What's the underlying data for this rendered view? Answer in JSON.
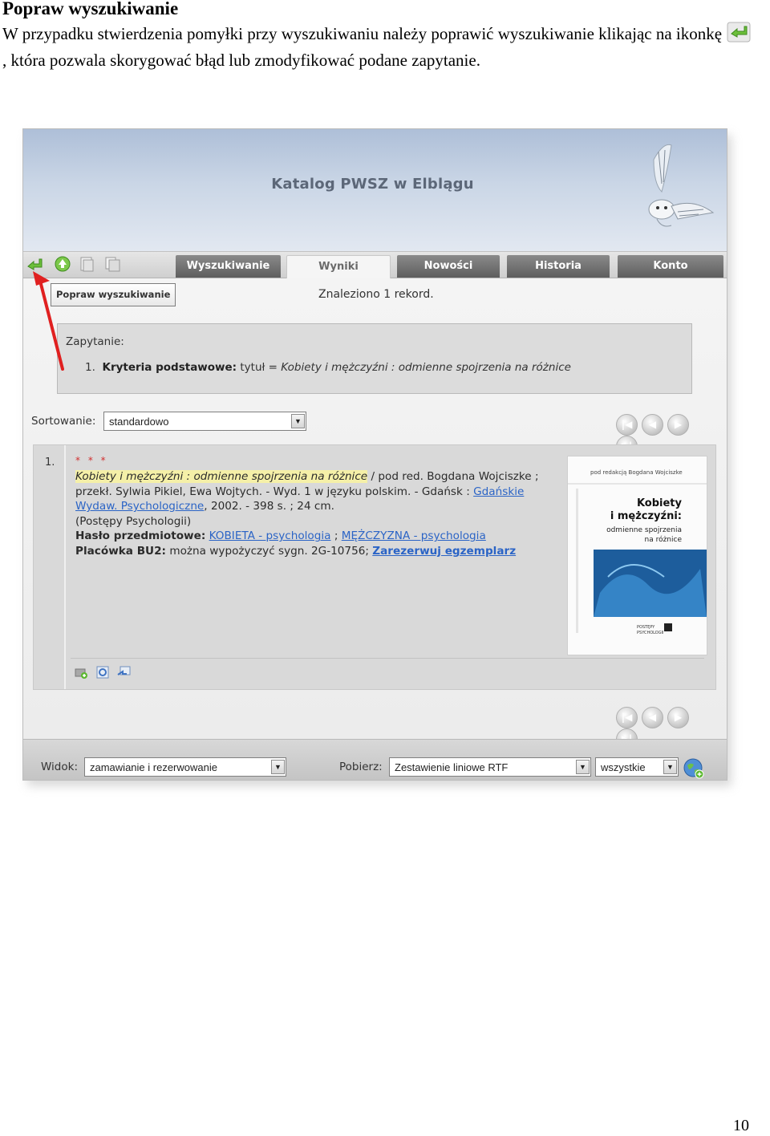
{
  "doc": {
    "heading": "Popraw wyszukiwanie",
    "para_before": "W przypadku stwierdzenia pomyłki przy wyszukiwaniu należy poprawić wyszukiwanie klikając na ikonkę",
    "para_after": ", która pozwala skorygować błąd lub zmodyfikować podane zapytanie.",
    "page_number": "10"
  },
  "catalog": {
    "title": "Katalog PWSZ w Elblągu",
    "tabs": [
      {
        "label": "Wyszukiwanie",
        "active": false
      },
      {
        "label": "Wyniki",
        "active": true
      },
      {
        "label": "Nowości",
        "active": false
      },
      {
        "label": "Historia",
        "active": false
      },
      {
        "label": "Konto",
        "active": false
      }
    ],
    "popraw_button": "Popraw wyszukiwanie",
    "found_text": "Znaleziono 1 rekord.",
    "query": {
      "label": "Zapytanie:",
      "number": "1.",
      "criteria_label": "Kryteria podstawowe:",
      "criteria_field": "tytuł =",
      "criteria_value": "Kobiety i mężczyźni : odmienne spojrzenia na różnice"
    },
    "sort": {
      "label": "Sortowanie:",
      "value": "standardowo"
    },
    "record": {
      "number": "1.",
      "stars": "* * *",
      "title": "Kobiety i mężczyźni : odmienne spojrzenia na różnice",
      "desc_1": " / pod red. Bogdana Wojciszke ; przekł. Sylwia Pikiel, Ewa Wojtych. - Wyd. 1 w języku polskim. - Gdańsk : ",
      "publisher_link": "Gdańskie Wydaw. Psychologiczne",
      "desc_2": ", 2002. - 398 s. ; 24 cm.",
      "series": "(Postępy Psychologii)",
      "subject_label": "Hasło przedmiotowe:",
      "subject_1": "KOBIETA - psychologia",
      "subject_sep": " ; ",
      "subject_2": "MĘŻCZYZNA - psychologia",
      "branch_label": "Placówka BU2:",
      "branch_text": " można wypożyczyć sygn. 2G-10756; ",
      "reserve_link": "Zarezerwuj egzemplarz"
    },
    "cover": {
      "editor_line": "pod redakcją Bogdana Wojciszke",
      "title_1": "Kobiety",
      "title_2": "i mężczyźni:",
      "subtitle_1": "odmienne spojrzenia",
      "subtitle_2": "na różnice",
      "series_1": "POSTĘPY",
      "series_2": "PSYCHOLOGII"
    },
    "footer": {
      "view_label": "Widok:",
      "view_value": "zamawianie i rezerwowanie",
      "download_label": "Pobierz:",
      "download_value": "Zestawienie liniowe RTF",
      "scope_value": "wszystkie"
    }
  }
}
